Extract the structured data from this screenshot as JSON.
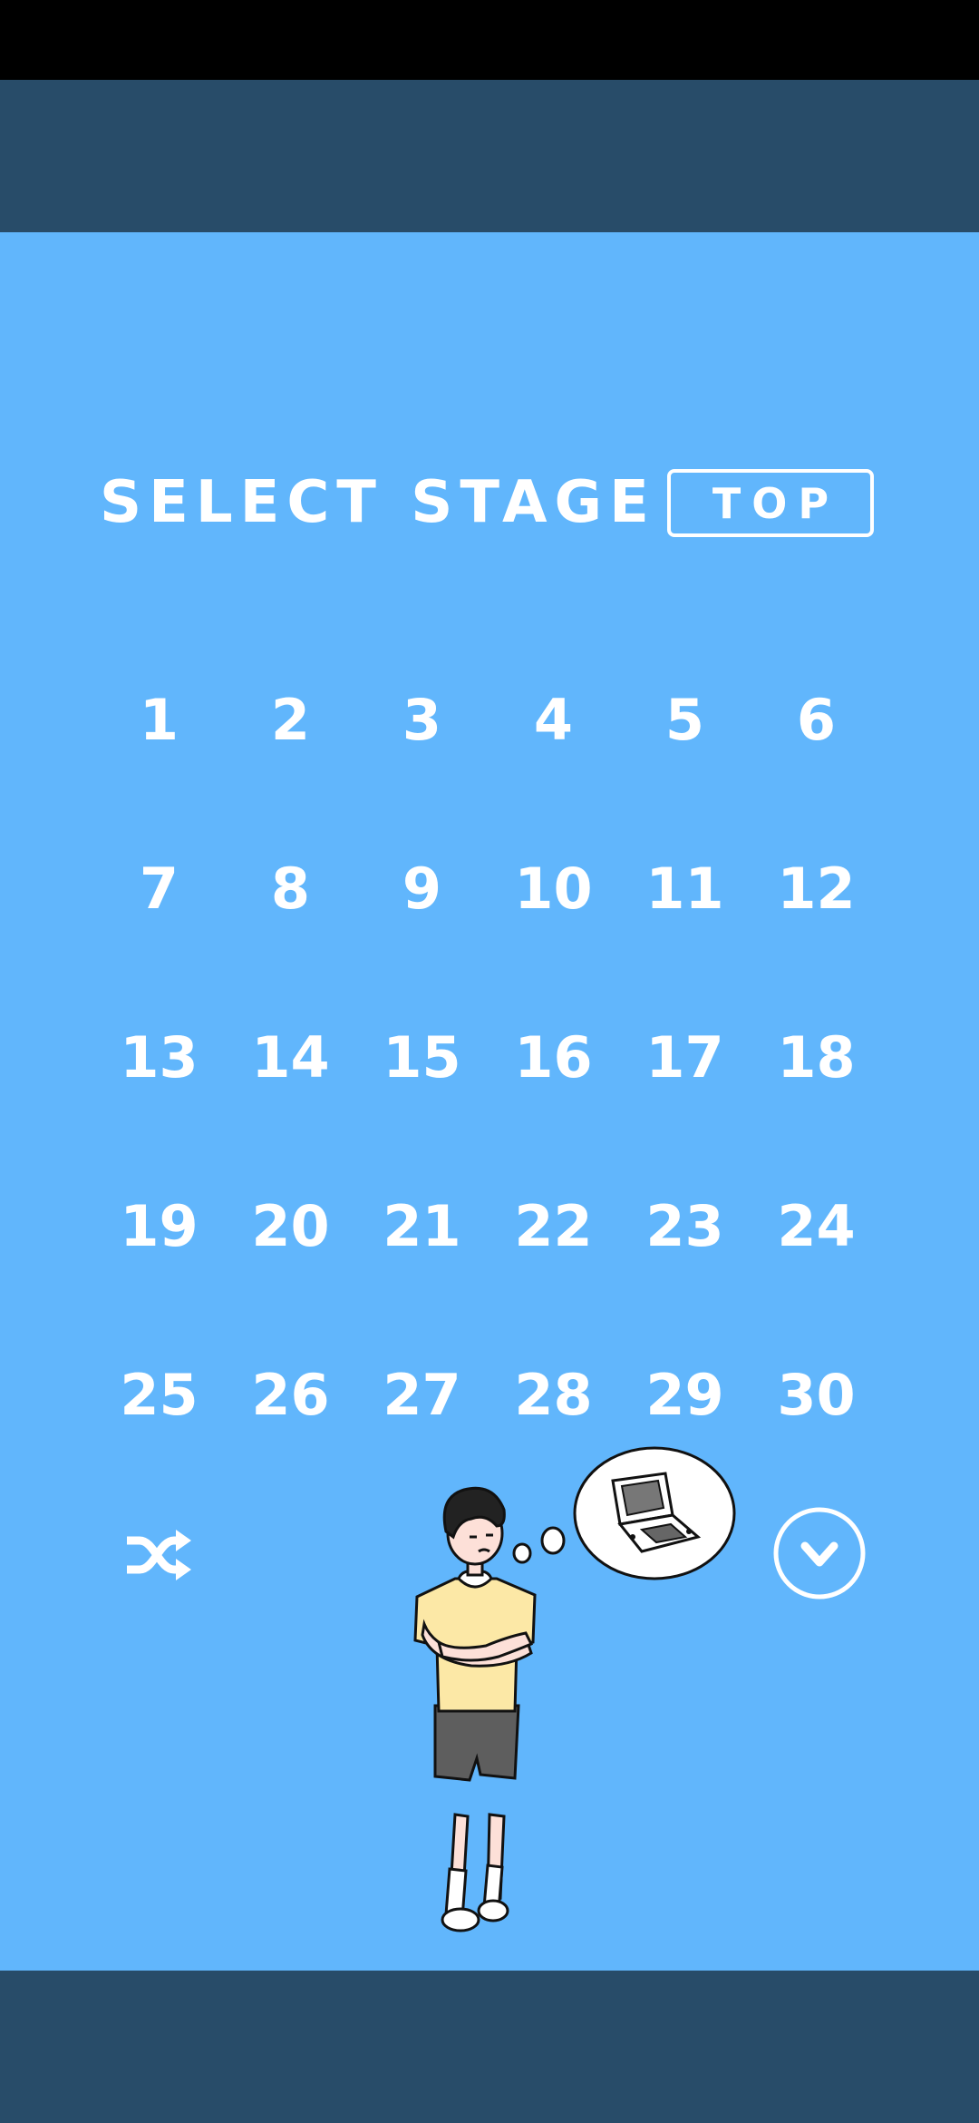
{
  "header": {
    "title": "SELECT STAGE",
    "top_label": "TOP"
  },
  "stages": [
    "1",
    "2",
    "3",
    "4",
    "5",
    "6",
    "7",
    "8",
    "9",
    "10",
    "11",
    "12",
    "13",
    "14",
    "15",
    "16",
    "17",
    "18",
    "19",
    "20",
    "21",
    "22",
    "23",
    "24",
    "25",
    "26",
    "27",
    "28",
    "29",
    "30"
  ],
  "icons": {
    "shuffle": "shuffle-icon",
    "next_page": "chevron-down-circle-icon",
    "character": "boy-thinking-illustration"
  },
  "colors": {
    "background": "#61b6fc",
    "band": "#284c69",
    "text": "#ffffff"
  }
}
